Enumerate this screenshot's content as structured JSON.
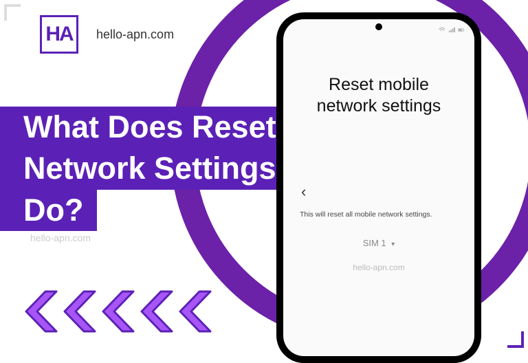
{
  "brand": {
    "logo_text": "HA",
    "site_top": "hello-apn.com",
    "watermark_left": "hello-apn.com",
    "watermark_screen": "hello-apn.com"
  },
  "headline": {
    "line1": "What Does Reset",
    "line2": "Network Settings",
    "line3": "Do?"
  },
  "chevrons": {
    "count": 5,
    "fill": "#a855f7",
    "stroke": "#5b21b6"
  },
  "colors": {
    "accent": "#5b21b6",
    "ring": "#6b21a8"
  },
  "phone": {
    "statusbar_left": "",
    "screen_title": "Reset mobile network settings",
    "back_glyph": "‹",
    "description": "This will reset all mobile network settings.",
    "sim_label": "SIM 1",
    "sim_caret": "▾"
  }
}
